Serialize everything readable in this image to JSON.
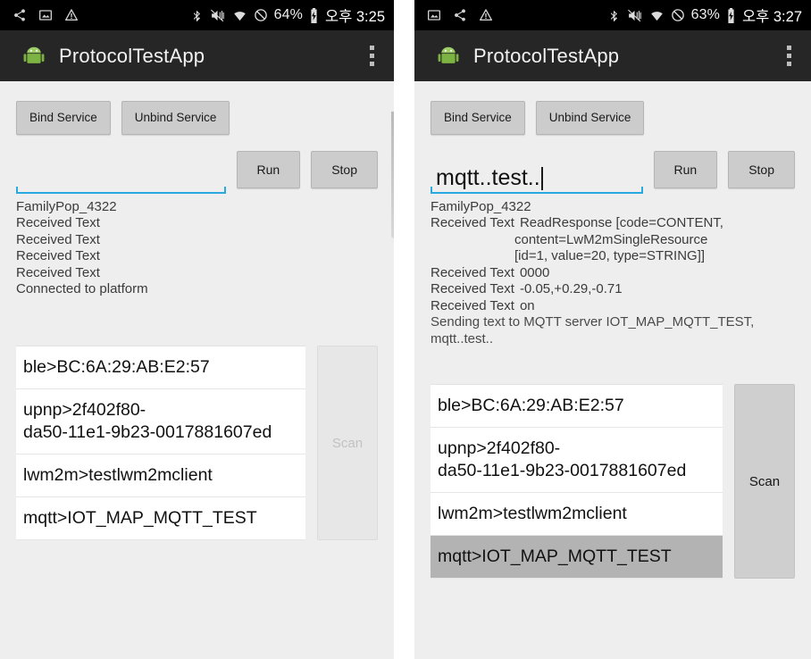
{
  "screens": [
    {
      "id": "left",
      "status_bar": {
        "icons_left": [
          "share-icon",
          "image-icon",
          "warning-icon"
        ],
        "icons_right": [
          "bluetooth-icon",
          "vibrate-mute-icon",
          "wifi-icon",
          "do-not-disturb-icon"
        ],
        "battery_percent": "64%",
        "battery_icon": "battery-charging-icon",
        "clock": "오후 3:25"
      },
      "action_bar": {
        "logo": "android-robot-icon",
        "title": "ProtocolTestApp",
        "overflow": "overflow-menu-icon"
      },
      "buttons": {
        "bind": "Bind Service",
        "unbind": "Unbind Service",
        "run": "Run",
        "stop": "Stop"
      },
      "input": {
        "value": "",
        "placeholder": "",
        "has_caret": false
      },
      "log": [
        {
          "text": "FamilyPop_4322"
        },
        {
          "text": "Received Text"
        },
        {
          "text": "Received Text"
        },
        {
          "text": "Received Text"
        },
        {
          "text": "Received Text"
        },
        {
          "text": "Connected to platform"
        }
      ],
      "devices": [
        {
          "label": "ble>BC:6A:29:AB:E2:57",
          "selected": false
        },
        {
          "label": "upnp>2f402f80-\nda50-11e1-9b23-0017881607ed",
          "selected": false
        },
        {
          "label": "lwm2m>testlwm2mclient",
          "selected": false
        },
        {
          "label": "mqtt>IOT_MAP_MQTT_TEST",
          "selected": false
        }
      ],
      "scan": {
        "label": "Scan",
        "enabled": false
      }
    },
    {
      "id": "right",
      "status_bar": {
        "icons_left": [
          "image-icon",
          "share-icon",
          "warning-icon"
        ],
        "icons_right": [
          "bluetooth-icon",
          "vibrate-mute-icon",
          "wifi-icon",
          "do-not-disturb-icon"
        ],
        "battery_percent": "63%",
        "battery_icon": "battery-charging-icon",
        "clock": "오후 3:27"
      },
      "action_bar": {
        "logo": "android-robot-icon",
        "title": "ProtocolTestApp",
        "overflow": "overflow-menu-icon"
      },
      "buttons": {
        "bind": "Bind Service",
        "unbind": "Unbind Service",
        "run": "Run",
        "stop": "Stop"
      },
      "input": {
        "value": "mqtt..test..",
        "placeholder": "",
        "has_caret": true
      },
      "log": [
        {
          "text": "FamilyPop_4322"
        },
        {
          "key": "Received Text",
          "value": "ReadResponse [code=CONTENT,"
        },
        {
          "indent": "content=LwM2mSingleResource"
        },
        {
          "indent": "[id=1, value=20, type=STRING]]"
        },
        {
          "key": "Received Text",
          "value": "0000"
        },
        {
          "key": "Received Text",
          "value": "-0.05,+0.29,-0.71"
        },
        {
          "key": "Received Text",
          "value": "on"
        },
        {
          "text": "Sending text to MQTT server IOT_MAP_MQTT_TEST,"
        },
        {
          "text": "mqtt..test.."
        }
      ],
      "devices": [
        {
          "label": "ble>BC:6A:29:AB:E2:57",
          "selected": false
        },
        {
          "label": "upnp>2f402f80-\nda50-11e1-9b23-0017881607ed",
          "selected": false
        },
        {
          "label": "lwm2m>testlwm2mclient",
          "selected": false
        },
        {
          "label": "mqtt>IOT_MAP_MQTT_TEST",
          "selected": true
        }
      ],
      "scan": {
        "label": "Scan",
        "enabled": true
      }
    }
  ],
  "colors": {
    "status_bar_bg": "#000000",
    "action_bar_bg": "#262626",
    "screen_bg": "#eeeeee",
    "accent_underline": "#2aa9e0",
    "selected_row": "#b3b3b3",
    "android_green": "#8bc34a"
  }
}
